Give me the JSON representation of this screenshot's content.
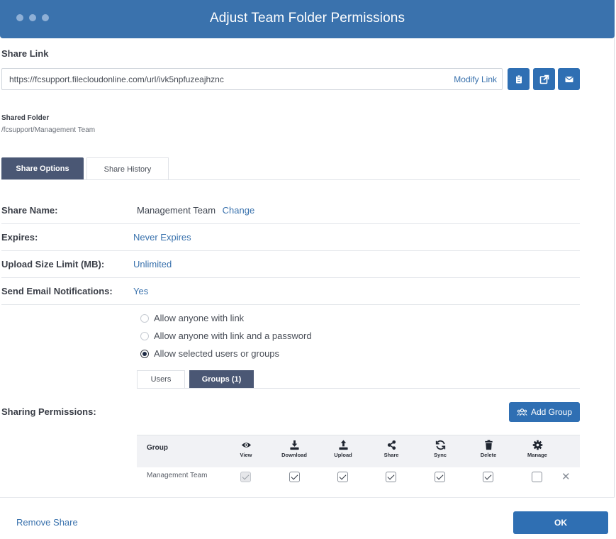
{
  "window": {
    "title": "Adjust Team Folder Permissions"
  },
  "share_link": {
    "label": "Share Link",
    "url": "https://fcsupport.filecloudonline.com/url/ivk5npfuzeajhznc",
    "modify_label": "Modify Link",
    "buttons": [
      "clipboard-icon",
      "open-external-icon",
      "email-icon"
    ]
  },
  "shared_folder": {
    "label": "Shared Folder",
    "path": "/fcsupport/Management Team"
  },
  "tabs": {
    "share_options": "Share Options",
    "share_history": "Share History"
  },
  "fields": {
    "share_name_label": "Share Name:",
    "share_name_value": "Management Team",
    "share_name_change": "Change",
    "expires_label": "Expires:",
    "expires_value": "Never Expires",
    "upload_limit_label": "Upload Size Limit (MB):",
    "upload_limit_value": "Unlimited",
    "email_notif_label": "Send Email Notifications:",
    "email_notif_value": "Yes"
  },
  "access": {
    "options": [
      "Allow anyone with link",
      "Allow anyone with link and a password",
      "Allow selected users or groups"
    ],
    "selected": "Allow selected users or groups"
  },
  "subtabs": {
    "users": "Users",
    "groups": "Groups (1)"
  },
  "permissions": {
    "label": "Sharing Permissions:",
    "add_group": "Add Group",
    "group_header": "Group",
    "columns": [
      "View",
      "Download",
      "Upload",
      "Share",
      "Sync",
      "Delete",
      "Manage"
    ],
    "rows": [
      {
        "name": "Management Team",
        "view": true,
        "download": true,
        "upload": true,
        "share": true,
        "sync": true,
        "delete": true,
        "manage": false
      }
    ]
  },
  "footer": {
    "remove_share": "Remove Share",
    "ok": "OK"
  },
  "colors": {
    "titlebar": "#3a72ad",
    "accent": "#2f6fb3",
    "active_tab": "#4a5774"
  }
}
